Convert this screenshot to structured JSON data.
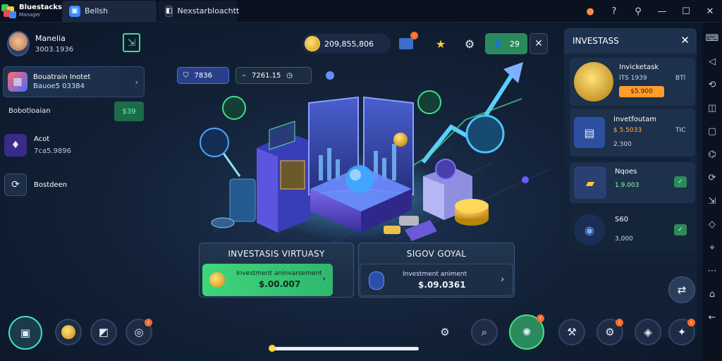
{
  "titlebar": {
    "brand_name": "Bluestacks",
    "brand_sub": "Manager",
    "tab1_label": "Bellsh",
    "tab2_label": "Nexstarbloachtt",
    "controls": [
      "●",
      "?",
      "⚲",
      "—",
      "☐",
      "✕"
    ]
  },
  "profile": {
    "name": "Manelia",
    "id": "3003.1936"
  },
  "offer": {
    "title": "Bouatrain Inotet",
    "value": "Bauoe5 03384"
  },
  "section": {
    "label": "Bobotloaian",
    "badge": "$39"
  },
  "left_items": [
    {
      "title": "Acot",
      "value": "7ca5.9896"
    },
    {
      "title": "Bostdeen",
      "value": ""
    }
  ],
  "resources": {
    "coins": "209,855,806",
    "friends_count": "29",
    "chip1": "7836",
    "chip2": "7261.15"
  },
  "cards": {
    "left_title": "INVESTASIS VIRTUASY",
    "left_btn_label": "Investment aninvarsement",
    "left_btn_value": "$.00.007",
    "right_title": "SIGOV GOYAL",
    "right_btn_label": "Investment animent",
    "right_btn_value": "$.09.0361"
  },
  "right_panel": {
    "title": "INVESTASS",
    "items": [
      {
        "title": "Invicketask",
        "sub": "ITS 1939",
        "badge": "BTl",
        "button": "$5.900",
        "value": ""
      },
      {
        "title": "Invetfoutam",
        "sub": "$ 5.5033",
        "badge": "TIC",
        "value": "2.300"
      },
      {
        "title": "Nqoes",
        "sub": "1.9.003",
        "value": ""
      },
      {
        "title": "S60",
        "sub": "",
        "value": "3,000"
      }
    ]
  },
  "bottom": {
    "progress_fraction": 0.02
  },
  "colors": {
    "accent_green": "#3fd67a",
    "accent_orange": "#ff9c2a",
    "panel_bg": "#172740"
  }
}
